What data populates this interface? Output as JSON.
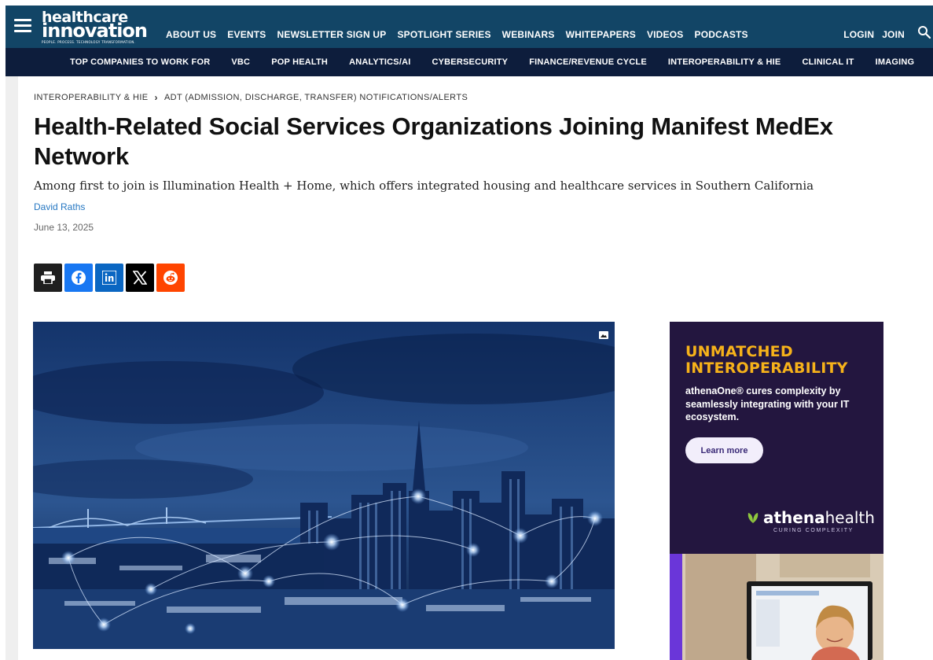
{
  "header": {
    "logo": {
      "line1": "healthcare",
      "line2": "innovation",
      "tagline": "PEOPLE. PROCESS. TECHNOLOGY TRANSFORMATION."
    },
    "nav": [
      {
        "label": "ABOUT US"
      },
      {
        "label": "EVENTS"
      },
      {
        "label": "NEWSLETTER SIGN UP"
      },
      {
        "label": "SPOTLIGHT SERIES"
      },
      {
        "label": "WEBINARS"
      },
      {
        "label": "WHITEPAPERS"
      },
      {
        "label": "VIDEOS"
      },
      {
        "label": "PODCASTS"
      }
    ],
    "login": "LOGIN",
    "join": "JOIN"
  },
  "subnav": [
    {
      "label": "TOP COMPANIES TO WORK FOR"
    },
    {
      "label": "VBC"
    },
    {
      "label": "POP HEALTH"
    },
    {
      "label": "ANALYTICS/AI"
    },
    {
      "label": "CYBERSECURITY"
    },
    {
      "label": "FINANCE/REVENUE CYCLE"
    },
    {
      "label": "INTEROPERABILITY & HIE"
    },
    {
      "label": "CLINICAL IT"
    },
    {
      "label": "IMAGING"
    }
  ],
  "breadcrumb": {
    "parent": "INTEROPERABILITY & HIE",
    "current": "ADT (ADMISSION, DISCHARGE, TRANSFER) NOTIFICATIONS/ALERTS"
  },
  "article": {
    "title": "Health-Related Social Services Organizations Joining Manifest MedEx Network",
    "subtitle": "Among first to join is Illumination Health + Home, which offers integrated housing and healthcare services in Southern California",
    "author": "David Raths",
    "date": "June 13, 2025"
  },
  "share": [
    {
      "name": "print-icon",
      "color": "#1f1f1f"
    },
    {
      "name": "facebook-icon",
      "color": "#1877f2"
    },
    {
      "name": "linkedin-icon",
      "color": "#0a66c2"
    },
    {
      "name": "x-icon",
      "color": "#000000"
    },
    {
      "name": "reddit-icon",
      "color": "#ff4500"
    }
  ],
  "ad": {
    "headline1": "UNMATCHED",
    "headline2": "INTEROPERABILITY",
    "body": "athenaOne® cures complexity by seamlessly integrating with your IT ecosystem.",
    "cta": "Learn more",
    "brand_bold": "athena",
    "brand_light": "health",
    "brand_tag": "CURING COMPLEXITY"
  },
  "colors": {
    "primary_bar": "#124566",
    "secondary_bar": "#0d1d3c",
    "link": "#2577c2",
    "ad_bg": "#23163f",
    "ad_accent": "#f6b21a"
  }
}
